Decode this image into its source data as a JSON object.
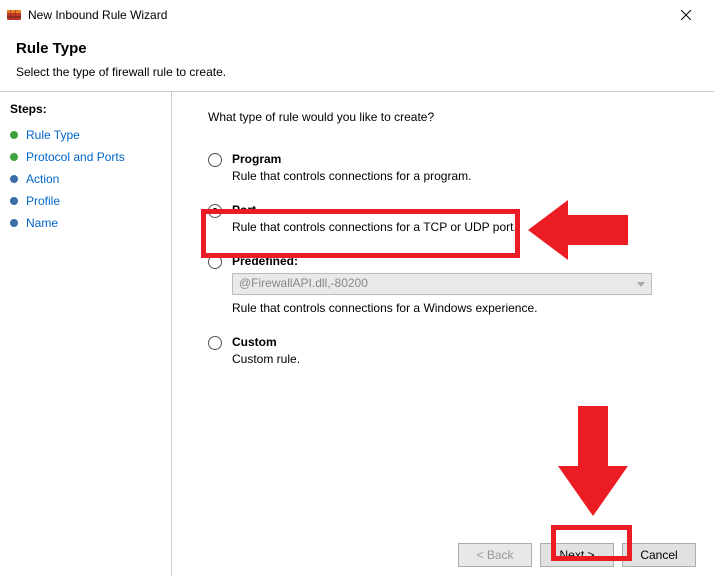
{
  "window": {
    "title": "New Inbound Rule Wizard"
  },
  "header": {
    "title": "Rule Type",
    "subtitle": "Select the type of firewall rule to create."
  },
  "sidebar": {
    "label": "Steps:",
    "items": [
      {
        "label": "Rule Type",
        "state": "current"
      },
      {
        "label": "Protocol and Ports",
        "state": "next"
      },
      {
        "label": "Action",
        "state": "pending"
      },
      {
        "label": "Profile",
        "state": "pending"
      },
      {
        "label": "Name",
        "state": "pending"
      }
    ]
  },
  "main": {
    "question": "What type of rule would you like to create?",
    "options": [
      {
        "id": "program",
        "title": "Program",
        "desc": "Rule that controls connections for a program.",
        "selected": false
      },
      {
        "id": "port",
        "title": "Port",
        "desc": "Rule that controls connections for a TCP or UDP port.",
        "selected": true
      },
      {
        "id": "predefined",
        "title": "Predefined:",
        "select_value": "@FirewallAPI.dll,-80200",
        "desc": "Rule that controls connections for a Windows experience.",
        "selected": false
      },
      {
        "id": "custom",
        "title": "Custom",
        "desc": "Custom rule.",
        "selected": false
      }
    ]
  },
  "buttons": {
    "back": "< Back",
    "next": "Next >",
    "cancel": "Cancel"
  }
}
